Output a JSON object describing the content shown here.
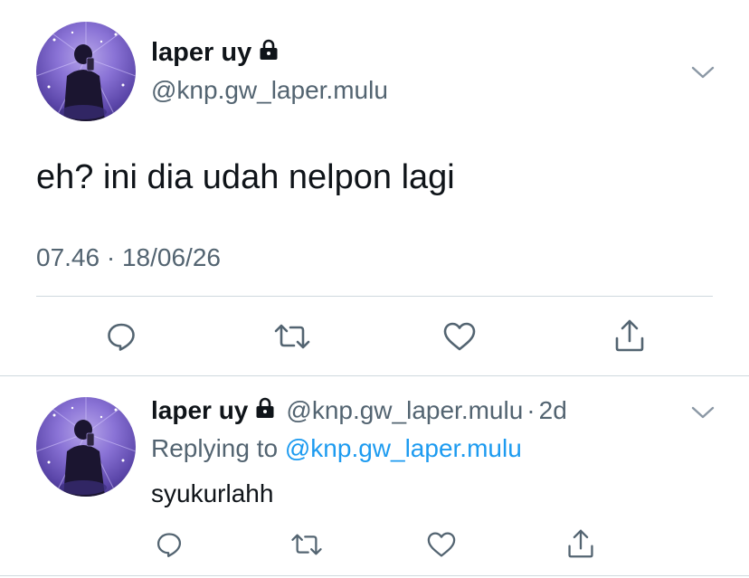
{
  "main_tweet": {
    "display_name": "laper uy",
    "handle": "@knp.gw_laper.mulu",
    "text": "eh? ini dia udah nelpon lagi",
    "time": "07.46",
    "separator": "·",
    "date": "18/06/26",
    "icons": {
      "lock": "lock-icon",
      "more": "chevron-down-icon",
      "reply": "reply-icon",
      "retweet": "retweet-icon",
      "like": "like-icon",
      "share": "share-icon"
    }
  },
  "reply_tweet": {
    "display_name": "laper uy",
    "handle": "@knp.gw_laper.mulu",
    "separator": "·",
    "age": "2d",
    "replying_prefix": "Replying to",
    "replying_to": "@knp.gw_laper.mulu",
    "text": "syukurlahh"
  },
  "colors": {
    "text": "#0f1419",
    "secondary": "#536471",
    "accent": "#1d9bf0",
    "divider": "#cfd9de"
  }
}
